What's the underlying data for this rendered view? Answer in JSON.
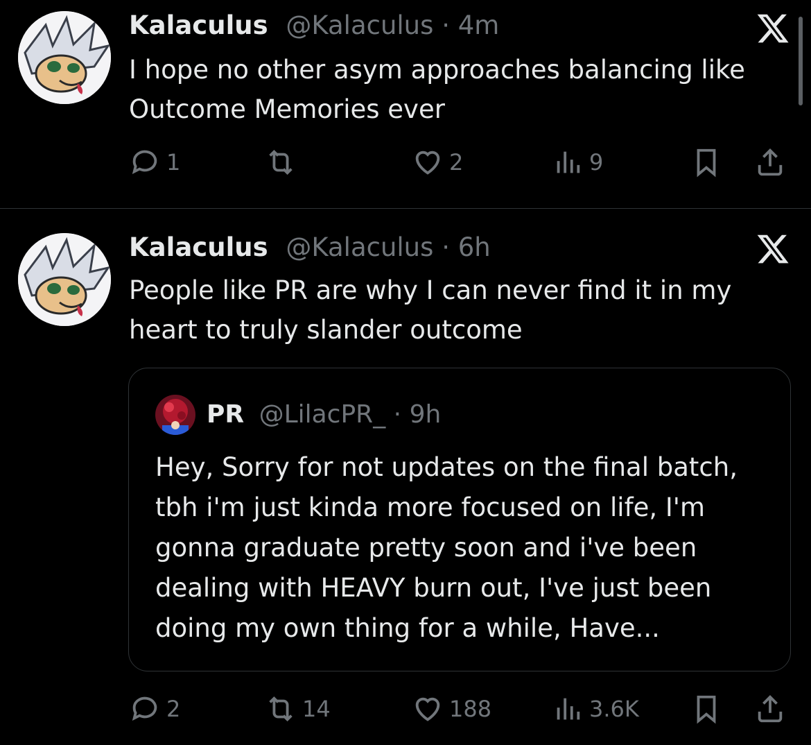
{
  "tweets": [
    {
      "author_name": "Kalaculus",
      "handle": "@Kalaculus",
      "separator": "·",
      "time": "4m",
      "text": "I hope no other asym approaches balancing like Outcome Memories ever",
      "replies": "1",
      "retweets": "",
      "likes": "2",
      "views": "9"
    },
    {
      "author_name": "Kalaculus",
      "handle": "@Kalaculus",
      "separator": "·",
      "time": "6h",
      "text": "People like PR are why I can never find it in my heart to truly slander outcome",
      "quoted": {
        "author_name": "PR",
        "handle": "@LilacPR_",
        "separator": "·",
        "time": "9h",
        "text": "Hey, Sorry for not updates on the final batch, tbh i'm just kinda more focused on life, I'm gonna graduate pretty soon and i've been dealing with HEAVY burn out, I've just been doing my own thing for a while, Have..."
      },
      "replies": "2",
      "retweets": "14",
      "likes": "188",
      "views": "3.6K"
    }
  ],
  "colors": {
    "background": "#000000",
    "text": "#e7e9ea",
    "muted": "#71767b",
    "border": "#2f3336"
  },
  "icons": [
    "x-logo-icon",
    "reply-icon",
    "retweet-icon",
    "like-icon",
    "views-icon",
    "bookmark-icon",
    "share-icon"
  ]
}
